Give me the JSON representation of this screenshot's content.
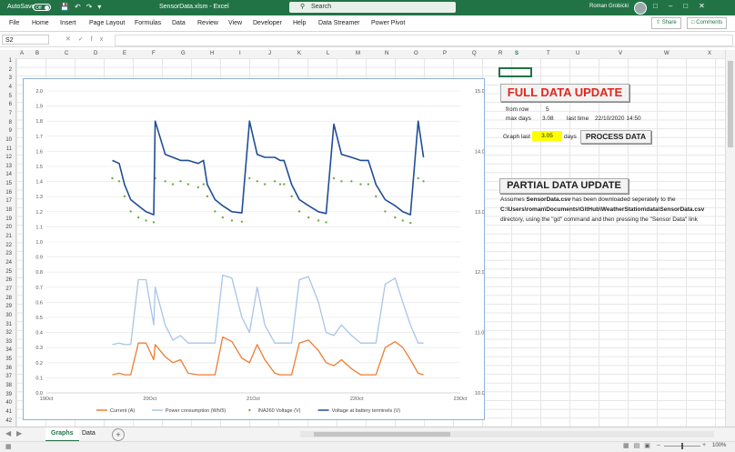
{
  "titlebar": {
    "autosave_label": "AutoSave",
    "autosave_state": "Off",
    "file_name": "SensorData.xlsm - Excel",
    "search_placeholder": "Search",
    "user_name": "Roman Grobicki",
    "accent_color": "#217346"
  },
  "ribbon": {
    "tabs": [
      "File",
      "Home",
      "Insert",
      "Page Layout",
      "Formulas",
      "Data",
      "Review",
      "View",
      "Developer",
      "Help",
      "Data Streamer",
      "Power Pivot"
    ],
    "share_label": "Share",
    "comments_label": "Comments"
  },
  "formula_bar": {
    "name_box": "S2",
    "fx_label": "fx",
    "value": ""
  },
  "columns": [
    "A",
    "B",
    "C",
    "D",
    "E",
    "F",
    "G",
    "H",
    "I",
    "J",
    "K",
    "L",
    "M",
    "N",
    "O",
    "P",
    "Q",
    "R",
    "S",
    "T",
    "U",
    "V",
    "W",
    "X"
  ],
  "rows": [
    "1",
    "2",
    "3",
    "4",
    "5",
    "6",
    "7",
    "8",
    "9",
    "10",
    "11",
    "12",
    "13",
    "14",
    "15",
    "16",
    "17",
    "18",
    "19",
    "20",
    "21",
    "22",
    "23",
    "24",
    "25",
    "26",
    "27",
    "28",
    "29",
    "30",
    "31",
    "32",
    "33",
    "34",
    "35",
    "36",
    "37",
    "38",
    "39",
    "40",
    "41",
    "42"
  ],
  "panel": {
    "full_update_label": "FULL DATA UPDATE",
    "from_row_label": "from row",
    "from_row_value": "5",
    "max_days_label": "max days",
    "max_days_value": "3.08",
    "last_time_label": "last time",
    "last_time_value": "22/10/2020 14:50",
    "graph_last_label": "Graph last",
    "graph_last_value": "3.05",
    "days_label": "days",
    "process_label": "PROCESS DATA",
    "partial_update_label": "PARTIAL DATA UPDATE",
    "note_line1_pre": "Assumes ",
    "note_line1_bold": "SensorData.csv",
    "note_line1_post": " has been downloaded seperately to the",
    "note_line2_bold": "C:\\Users\\roman\\Documents\\GitHub\\WeatherStation\\data\\SensorData.csv",
    "note_line3": "directory, using the \"gd\" command and then pressing the \"Sensor Data\" link"
  },
  "sheets": {
    "tabs": [
      "Graphs",
      "Data"
    ],
    "active": "Graphs",
    "add_label": "+"
  },
  "status": {
    "zoom": "100%"
  },
  "chart_data": {
    "type": "line",
    "title": "",
    "y_left": {
      "min": 0.0,
      "max": 2.0,
      "ticks": [
        "0.0",
        "0.1",
        "0.2",
        "0.3",
        "0.4",
        "0.5",
        "0.6",
        "0.7",
        "0.8",
        "0.9",
        "1.0",
        "1.1",
        "1.2",
        "1.3",
        "1.4",
        "1.5",
        "1.6",
        "1.7",
        "1.8",
        "1.9",
        "2.0"
      ]
    },
    "y_right": {
      "min": 10.0,
      "max": 15.0,
      "ticks": [
        "10.0",
        "11.0",
        "12.0",
        "13.0",
        "14.0",
        "15.0"
      ]
    },
    "x_ticks": [
      "19Oct",
      "20Oct",
      "21Oct",
      "22Oct",
      "23Oct"
    ],
    "x_range": [
      0,
      4
    ],
    "legend_position": "bottom",
    "series": [
      {
        "name": "Current (A)",
        "axis": "left",
        "color": "#ed7d31",
        "style": "line",
        "x": [
          2.86,
          2.95,
          3.02,
          3.1,
          3.2,
          3.3,
          3.4,
          3.42,
          3.55,
          3.65,
          3.75,
          3.85,
          3.98,
          4.05,
          4.1,
          4.2,
          4.3,
          4.42,
          4.55,
          4.65,
          4.75,
          4.85,
          4.98,
          5.05,
          5.1,
          5.2,
          5.3,
          5.42,
          5.55,
          5.65,
          5.75,
          5.85,
          5.98,
          6.1,
          6.2,
          6.3,
          6.42,
          6.55,
          6.65,
          6.75,
          6.85,
          6.92
        ],
        "y": [
          0.12,
          0.13,
          0.12,
          0.12,
          0.33,
          0.33,
          0.22,
          0.32,
          0.24,
          0.2,
          0.22,
          0.13,
          0.12,
          0.12,
          0.12,
          0.12,
          0.37,
          0.34,
          0.23,
          0.2,
          0.32,
          0.22,
          0.13,
          0.12,
          0.12,
          0.12,
          0.33,
          0.35,
          0.28,
          0.2,
          0.18,
          0.22,
          0.16,
          0.12,
          0.12,
          0.12,
          0.3,
          0.34,
          0.3,
          0.22,
          0.13,
          0.12
        ]
      },
      {
        "name": "Power consumption  (Wh/5)",
        "axis": "left",
        "color": "#aac4e8",
        "style": "line",
        "x": [
          2.86,
          2.95,
          3.02,
          3.1,
          3.2,
          3.3,
          3.4,
          3.42,
          3.55,
          3.65,
          3.75,
          3.85,
          3.98,
          4.05,
          4.1,
          4.2,
          4.3,
          4.42,
          4.55,
          4.65,
          4.75,
          4.85,
          4.98,
          5.05,
          5.1,
          5.2,
          5.3,
          5.42,
          5.55,
          5.65,
          5.75,
          5.85,
          5.98,
          6.1,
          6.2,
          6.3,
          6.42,
          6.55,
          6.65,
          6.75,
          6.85,
          6.92
        ],
        "y": [
          0.32,
          0.33,
          0.32,
          0.32,
          0.75,
          0.75,
          0.45,
          0.7,
          0.45,
          0.35,
          0.38,
          0.33,
          0.33,
          0.33,
          0.33,
          0.33,
          0.78,
          0.76,
          0.5,
          0.4,
          0.7,
          0.45,
          0.33,
          0.33,
          0.33,
          0.33,
          0.75,
          0.77,
          0.6,
          0.4,
          0.38,
          0.45,
          0.38,
          0.33,
          0.33,
          0.33,
          0.72,
          0.76,
          0.6,
          0.45,
          0.33,
          0.33
        ]
      },
      {
        "name": "INA260 Voltage (V)",
        "axis": "right",
        "color": "#70ad47",
        "style": "markers",
        "x": [
          2.86,
          2.95,
          3.02,
          3.1,
          3.2,
          3.3,
          3.4,
          3.42,
          3.55,
          3.65,
          3.75,
          3.85,
          3.98,
          4.05,
          4.1,
          4.2,
          4.3,
          4.42,
          4.55,
          4.65,
          4.75,
          4.85,
          4.98,
          5.05,
          5.1,
          5.2,
          5.3,
          5.42,
          5.55,
          5.65,
          5.75,
          5.85,
          5.98,
          6.1,
          6.2,
          6.3,
          6.42,
          6.55,
          6.65,
          6.75,
          6.85,
          6.92
        ],
        "y": [
          13.6,
          13.55,
          13.3,
          13.05,
          12.95,
          12.9,
          12.87,
          13.6,
          13.55,
          13.5,
          13.55,
          13.5,
          13.45,
          13.5,
          13.3,
          13.05,
          12.95,
          12.9,
          12.88,
          13.6,
          13.55,
          13.5,
          13.55,
          13.5,
          13.5,
          13.3,
          13.05,
          12.95,
          12.9,
          12.87,
          13.6,
          13.55,
          13.55,
          13.5,
          13.5,
          13.3,
          13.05,
          12.95,
          12.9,
          12.86,
          13.6,
          13.55
        ]
      },
      {
        "name": "Voltage at battery terminels (V)",
        "axis": "right",
        "color": "#1f4e96",
        "style": "line",
        "x": [
          2.86,
          2.95,
          3.02,
          3.1,
          3.2,
          3.3,
          3.4,
          3.42,
          3.55,
          3.65,
          3.75,
          3.85,
          3.98,
          4.05,
          4.1,
          4.2,
          4.3,
          4.42,
          4.55,
          4.65,
          4.75,
          4.85,
          4.98,
          5.05,
          5.1,
          5.2,
          5.3,
          5.42,
          5.55,
          5.65,
          5.75,
          5.85,
          5.98,
          6.1,
          6.2,
          6.3,
          6.42,
          6.55,
          6.65,
          6.75,
          6.85,
          6.92
        ],
        "y": [
          13.85,
          13.8,
          13.45,
          13.2,
          13.1,
          13.0,
          12.95,
          14.5,
          13.95,
          13.9,
          13.85,
          13.85,
          13.8,
          13.85,
          13.45,
          13.2,
          13.1,
          13.0,
          12.98,
          14.5,
          13.95,
          13.9,
          13.9,
          13.85,
          13.85,
          13.45,
          13.2,
          13.1,
          13.0,
          12.97,
          14.45,
          13.95,
          13.9,
          13.85,
          13.85,
          13.45,
          13.2,
          13.1,
          13.0,
          12.95,
          14.5,
          13.9
        ]
      }
    ]
  }
}
